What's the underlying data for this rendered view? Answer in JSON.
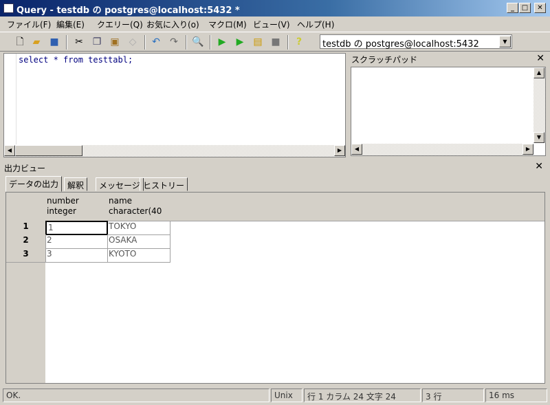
{
  "window": {
    "title": "Query - testdb の postgres@localhost:5432 *",
    "minimize": "_",
    "maximize": "□",
    "close": "✕"
  },
  "menu": [
    "ファイル(F)",
    "編集(E)",
    "クエリー(Q)",
    "お気に入り(o)",
    "マクロ(M)",
    "ビュー(V)",
    "ヘルプ(H)"
  ],
  "toolbar": {
    "connection": "testdb の postgres@localhost:5432",
    "help": "?"
  },
  "editor": {
    "code": "select * from testtabl;"
  },
  "scratchpad": {
    "title": "スクラッチパッド",
    "close": "✕"
  },
  "output": {
    "title": "出力ビュー",
    "close": "✕",
    "tabs": [
      "データの出力",
      "解釈",
      "メッセージ",
      "ヒストリー"
    ],
    "columns": [
      {
        "name": "number",
        "type": "integer"
      },
      {
        "name": "name",
        "type": "character(40"
      }
    ],
    "rows": [
      {
        "n": "1",
        "number": "1",
        "name": "TOKYO"
      },
      {
        "n": "2",
        "number": "2",
        "name": "OSAKA"
      },
      {
        "n": "3",
        "number": "3",
        "name": "KYOTO"
      }
    ]
  },
  "status": {
    "message": "OK.",
    "eol": "Unix",
    "position": "行 1 カラム 24  文字 24",
    "rows": "3 行",
    "time": "16 ms"
  }
}
